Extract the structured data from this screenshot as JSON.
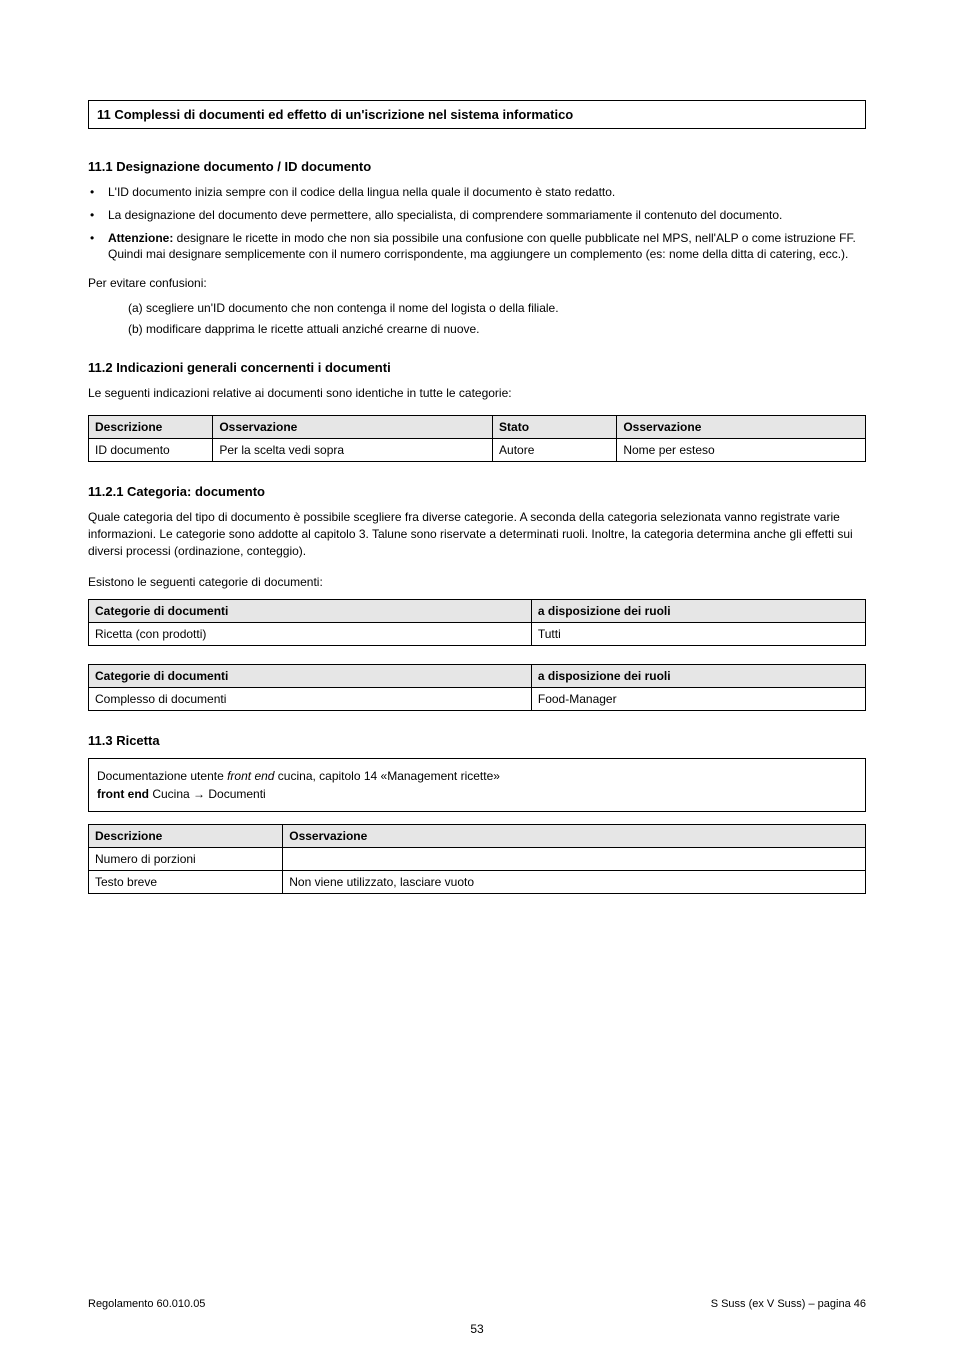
{
  "titlebox": "11   Complessi di documenti ed effetto di un'iscrizione nel sistema informatico",
  "sec1": {
    "heading": "11.1   Designazione documento / ID documento",
    "bullets": [
      "L'ID documento inizia sempre con il codice della lingua nella quale il documento è stato redatto.",
      "La designazione del documento deve permettere, allo specialista, di comprendere sommariamente il contenuto del documento."
    ],
    "labeled": {
      "label": "Attenzione:",
      "text": "designare le ricette in modo che non sia possibile una confusione con quelle pubblicate nel MPS, nell'ALP o come istruzione FF. Quindi mai designare semplicemente con il numero corrispondente, ma aggiungere un complemento (es: nome della ditta di catering, ecc.)."
    },
    "subhead": "Per evitare confusioni:",
    "sublist": [
      "(a)   scegliere un'ID documento che non contenga il nome del logista o della filiale.",
      "(b)   modificare dapprima le ricette attuali anziché crearne di nuove."
    ]
  },
  "sec2": {
    "heading": "11.2   Indicazioni generali concernenti i documenti",
    "intro": "Le seguenti indicazioni relative ai documenti sono identiche in tutte le categorie:",
    "table1": {
      "headers": [
        "Descrizione",
        "Osservazione",
        "Stato",
        "Osservazione"
      ],
      "row": [
        "ID documento",
        "Per la scelta vedi sopra",
        "Autore",
        "Nome per esteso"
      ]
    },
    "subsec": {
      "heading": "11.2.1   Categoria: documento",
      "text": "Quale categoria del tipo di documento è possibile scegliere fra diverse categorie. A seconda della categoria selezionata vanno registrate varie informazioni. Le categorie sono addotte al capitolo 3. Talune sono riservate a determinati ruoli. Inoltre, la categoria determina anche gli effetti sui diversi processi (ordinazione, conteggio).",
      "tables_label": "Esistono le seguenti categorie di documenti:",
      "table2": {
        "headers": [
          "Categorie di documenti",
          "a disposizione dei ruoli"
        ],
        "row": [
          "Ricetta (con prodotti)",
          "Tutti"
        ]
      },
      "table3": {
        "headers": [
          "Categorie di documenti",
          "a disposizione dei ruoli"
        ],
        "row": [
          "Complesso di documenti",
          "Food-Manager"
        ]
      }
    }
  },
  "sec3": {
    "heading": "11.3   Ricetta",
    "docbox": {
      "line1_plain": "Documentazione utente ",
      "line1_italic": "front end",
      "line1_rest": " cucina, capitolo 14 «Management ricette»",
      "line2_bold": "front end",
      "line2_rest": " Cucina → Documenti"
    },
    "table4": {
      "headers": [
        "Descrizione",
        "Osservazione"
      ],
      "rows": [
        [
          "Numero di porzioni",
          ""
        ],
        [
          "Testo breve",
          "Non viene utilizzato, lasciare vuoto"
        ]
      ]
    }
  },
  "footer": {
    "left": "Regolamento 60.010.05",
    "right": "S Suss (ex V Suss) – pagina 46"
  },
  "pagenum": "53"
}
